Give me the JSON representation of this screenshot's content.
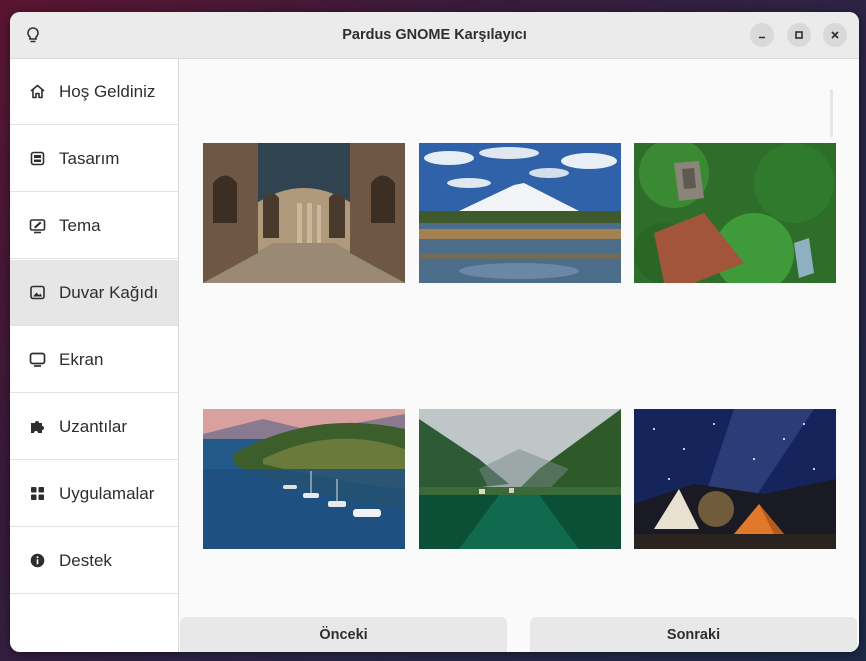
{
  "window": {
    "title": "Pardus GNOME Karşılayıcı"
  },
  "sidebar": {
    "items": [
      {
        "label": "Hoş Geldiniz",
        "icon": "home-icon"
      },
      {
        "label": "Tasarım",
        "icon": "layout-icon"
      },
      {
        "label": "Tema",
        "icon": "theme-icon"
      },
      {
        "label": "Duvar Kağıdı",
        "icon": "wallpaper-icon",
        "active": true
      },
      {
        "label": "Ekran",
        "icon": "display-icon"
      },
      {
        "label": "Uzantılar",
        "icon": "puzzle-icon"
      },
      {
        "label": "Uygulamalar",
        "icon": "apps-grid-icon"
      },
      {
        "label": "Destek",
        "icon": "info-icon"
      }
    ]
  },
  "wallpapers": [
    {
      "subject": "arched stone courtyard"
    },
    {
      "subject": "snowy mountain and lake"
    },
    {
      "subject": "castle ruin on green hill"
    },
    {
      "subject": "boats in a bay"
    },
    {
      "subject": "green lake between mountains"
    },
    {
      "subject": "camping tents under milky way"
    }
  ],
  "footer": {
    "previous_label": "Önceki",
    "next_label": "Sonraki"
  },
  "colors": {
    "titlebar": "#ebebeb",
    "sidebar_active": "#e6e6e6",
    "button": "#e8e8e8"
  }
}
